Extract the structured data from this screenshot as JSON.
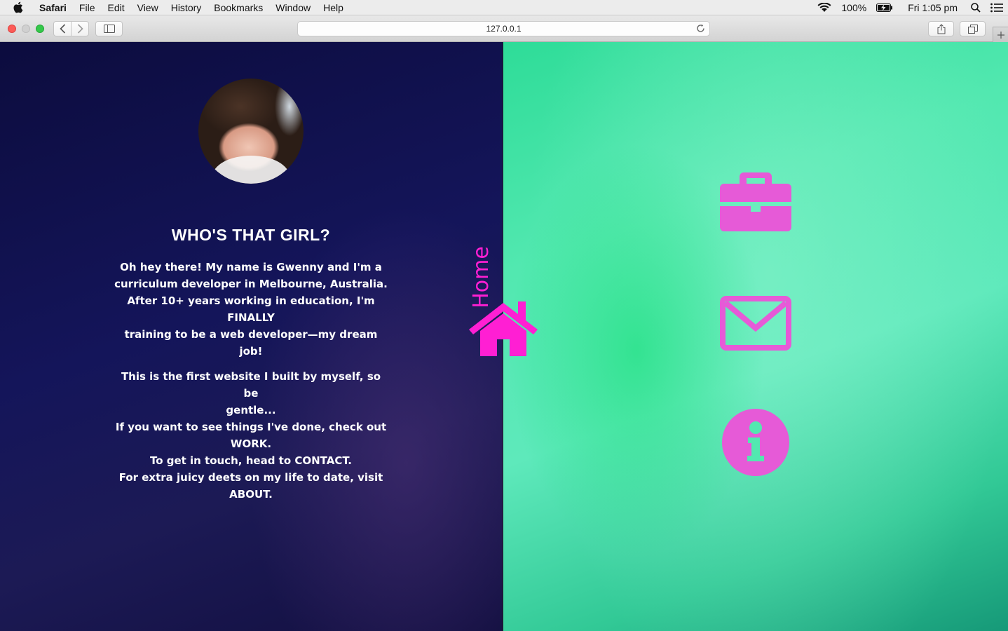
{
  "menubar": {
    "apple_icon": "apple-icon",
    "app_name": "Safari",
    "items": [
      "File",
      "Edit",
      "View",
      "History",
      "Bookmarks",
      "Window",
      "Help"
    ],
    "status": {
      "wifi_icon": "wifi-icon",
      "battery_percent": "100%",
      "battery_icon": "battery-charging-icon",
      "clock": "Fri 1:05 pm",
      "spotlight_icon": "search-icon",
      "notification_icon": "list-icon"
    }
  },
  "browser": {
    "url": "127.0.0.1",
    "buttons": [
      "back",
      "forward",
      "sidebar",
      "reload",
      "share",
      "tabs",
      "new-tab"
    ]
  },
  "page": {
    "heading": "WHO'S THAT GIRL?",
    "intro_lines": [
      "Oh hey there! My name is Gwenny and I'm a",
      "curriculum developer in Melbourne, Australia.",
      "After 10+ years working in education, I'm FINALLY",
      "training to be a web developer—my dream job!"
    ],
    "detail_lines": [
      "This is the first website I built by myself, so be",
      "gentle...",
      "If you want to see things I've done, check out",
      "WORK.",
      "To get in touch, head to CONTACT.",
      "For extra juicy deets on my life to date, visit",
      "ABOUT."
    ],
    "home_label": "Home",
    "nav_icons": [
      "home-icon",
      "briefcase-icon",
      "envelope-icon",
      "info-icon"
    ],
    "colors": {
      "accent_pink": "#ff1fd3",
      "icon_pink": "#e65ad7",
      "left_bg": "#13145a",
      "right_bg": "#4fe6ae"
    }
  }
}
